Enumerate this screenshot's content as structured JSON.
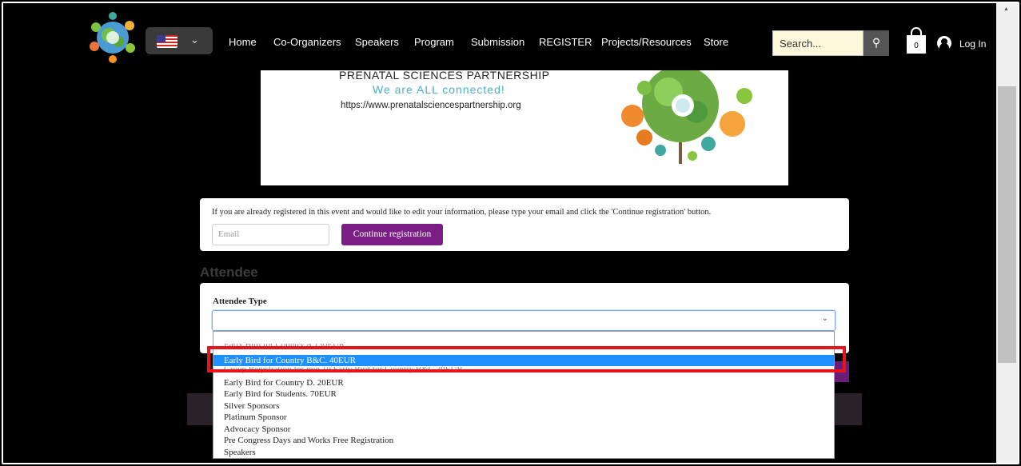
{
  "nav": {
    "items": [
      "Home",
      "Co-Organizers",
      "Speakers",
      "Program",
      "Submission",
      "REGISTER",
      "Projects/Resources",
      "Store"
    ],
    "search_placeholder": "Search...",
    "cart_count": "0",
    "login_label": "Log In"
  },
  "banner": {
    "title": "PRENATAL SCIENCES PARTNERSHIP",
    "slogan": "We are ALL connected!",
    "url": "https://www.prenatalsciencespartnership.org"
  },
  "registration": {
    "info_text": "If you are already registered in this event and would like to edit your information, please type your email and click the 'Continue registration' button.",
    "email_placeholder": "Email",
    "continue_label": "Continue registration"
  },
  "attendee": {
    "heading": "Attendee",
    "type_label": "Attendee Type",
    "selected_value": ""
  },
  "dropdown": {
    "options": [
      "Early Bird for Country A 130EUR",
      "Early Bird for Country B&C. 40EUR",
      "Group Registration for min 10 Early Bird for Country B&C 30EUR",
      "Early Bird for Country D. 20EUR",
      "Early Bird for Students. 70EUR",
      "Silver Sponsors",
      "Platinum Sponsor",
      "Advocacy Sponsor",
      "Pre Congress Days and Works Free Registration",
      "Speakers"
    ],
    "selected_index": 1
  },
  "colors": {
    "purple": "#7a1e85",
    "highlight": "#e8141c",
    "option_selected": "#1e90ff",
    "slogan": "#4db0c5"
  }
}
